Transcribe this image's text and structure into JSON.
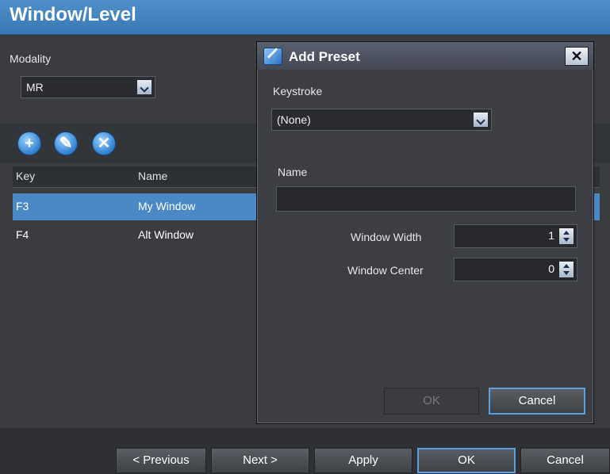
{
  "header": {
    "title": "Window/Level"
  },
  "modality": {
    "label": "Modality",
    "value": "MR"
  },
  "toolbar": {
    "add_icon": "plus-icon",
    "edit_icon": "pencil-icon",
    "delete_icon": "x-icon"
  },
  "table": {
    "columns": [
      "Key",
      "Name"
    ],
    "rows": [
      {
        "key": "F3",
        "name": "My Window",
        "selected": true
      },
      {
        "key": "F4",
        "name": "Alt Window",
        "selected": false
      }
    ]
  },
  "footer": {
    "previous": "< Previous",
    "next": "Next >",
    "apply": "Apply",
    "ok": "OK",
    "cancel": "Cancel"
  },
  "dialog": {
    "title": "Add Preset",
    "close": "✕",
    "keystroke_label": "Keystroke",
    "keystroke_value": "(None)",
    "name_label": "Name",
    "name_value": "",
    "window_width_label": "Window Width",
    "window_width_value": "1",
    "window_center_label": "Window Center",
    "window_center_value": "0",
    "ok": "OK",
    "cancel": "Cancel"
  },
  "colors": {
    "accent": "#4a89c6",
    "header": "#3d80bf",
    "background": "#3a3c40"
  }
}
